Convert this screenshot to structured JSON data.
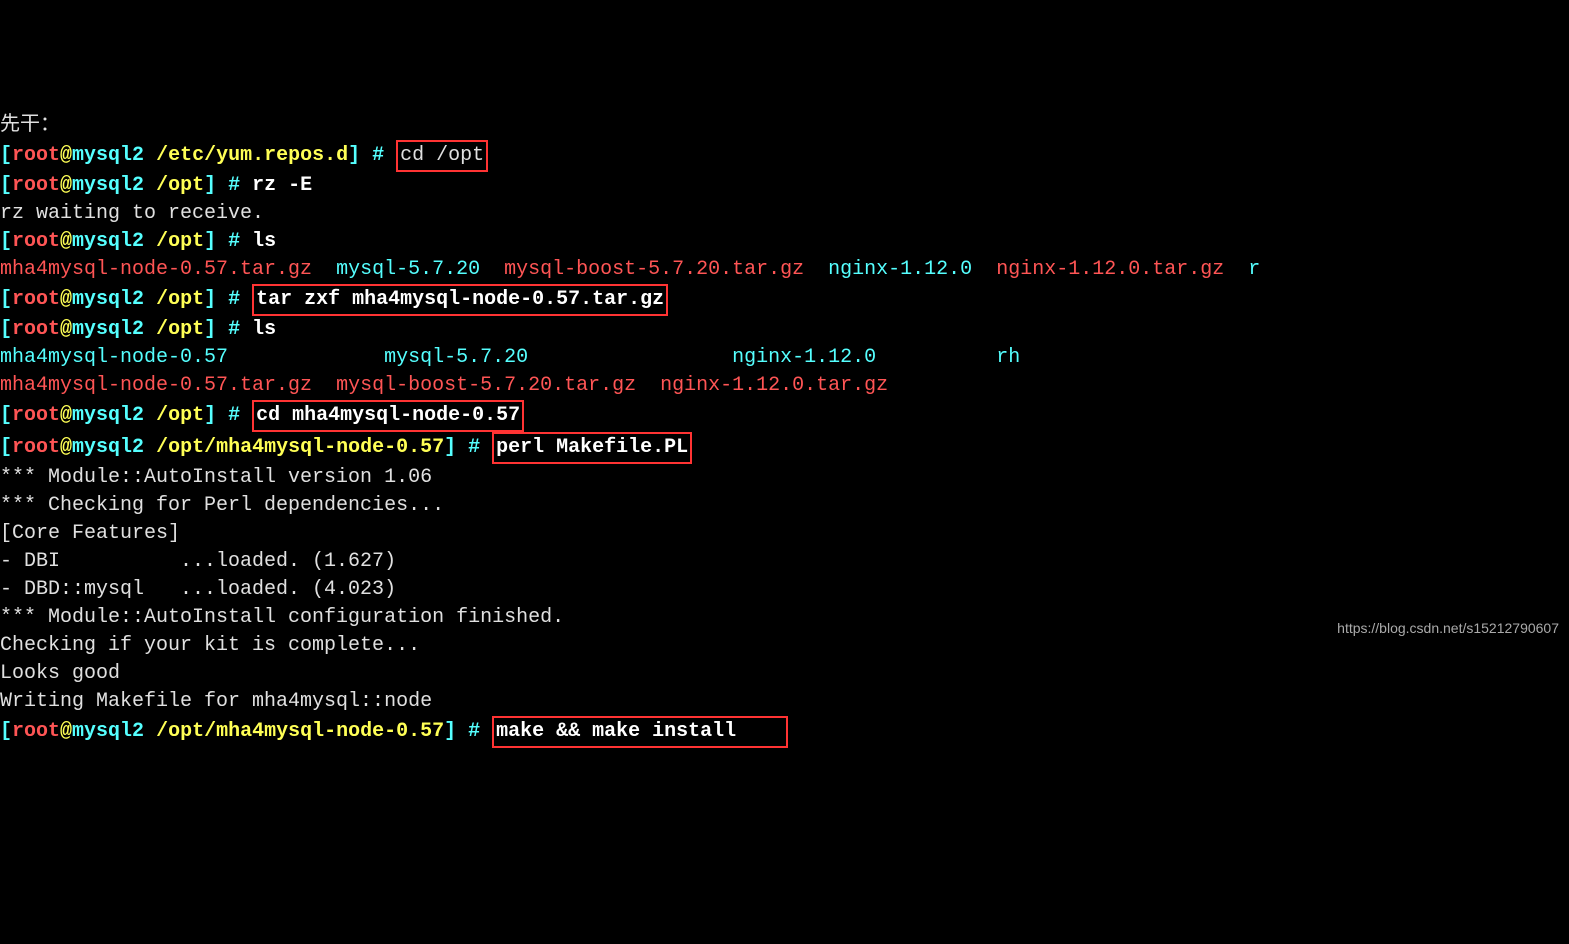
{
  "top_fragment": "先干：",
  "lines": {
    "l1_prompt_open": "[",
    "l1_user": "root",
    "l1_at": "@",
    "l1_host": "mysql2",
    "l1_path": " /etc/yum.repos.d",
    "l1_prompt_close": "] # ",
    "l1_cmd": "cd /opt",
    "l2_prompt_open": "[",
    "l2_user": "root",
    "l2_at": "@",
    "l2_host": "mysql2",
    "l2_path": " /opt",
    "l2_prompt_close": "] # ",
    "l2_cmd": "rz -E",
    "l3": "rz waiting to receive.",
    "l4_prompt_open": "[",
    "l4_user": "root",
    "l4_at": "@",
    "l4_host": "mysql2",
    "l4_path": " /opt",
    "l4_prompt_close": "] # ",
    "l4_cmd": "ls",
    "l5_a": "mha4mysql-node-0.57.tar.gz",
    "l5_b": "  mysql-5.7.20  ",
    "l5_c": "mysql-boost-5.7.20.tar.gz",
    "l5_d": "  nginx-1.12.0  ",
    "l5_e": "nginx-1.12.0.tar.gz  ",
    "l5_f": "r",
    "l6_prompt_open": "[",
    "l6_user": "root",
    "l6_at": "@",
    "l6_host": "mysql2",
    "l6_path": " /opt",
    "l6_prompt_close": "] # ",
    "l6_cmd": "tar zxf mha4mysql-node-0.57.tar.gz",
    "l7_prompt_open": "[",
    "l7_user": "root",
    "l7_at": "@",
    "l7_host": "mysql2",
    "l7_path": " /opt",
    "l7_prompt_close": "] # ",
    "l7_cmd": "ls",
    "l8_a": "mha4mysql-node-0.57",
    "l8_b": "             mysql-5.7.20",
    "l8_c": "                 nginx-1.12.0",
    "l8_d": "          rh",
    "l9_a": "mha4mysql-node-0.57.tar.gz",
    "l9_b": "  mysql-boost-5.7.20.tar.gz",
    "l9_c": "  nginx-1.12.0.tar.gz",
    "l10_prompt_open": "[",
    "l10_user": "root",
    "l10_at": "@",
    "l10_host": "mysql2",
    "l10_path": " /opt",
    "l10_prompt_close": "] # ",
    "l10_cmd": "cd mha4mysql-node-0.57",
    "l11_prompt_open": "[",
    "l11_user": "root",
    "l11_at": "@",
    "l11_host": "mysql2",
    "l11_path": " /opt/mha4mysql-node-0.57",
    "l11_prompt_close": "] # ",
    "l11_cmd": "perl Makefile.PL",
    "l12": "*** Module::AutoInstall version 1.06",
    "l13": "*** Checking for Perl dependencies...",
    "l14": "[Core Features]",
    "l15": "- DBI          ...loaded. (1.627)",
    "l16": "- DBD::mysql   ...loaded. (4.023)",
    "l17": "*** Module::AutoInstall configuration finished.",
    "l18": "Checking if your kit is complete...",
    "l19": "Looks good",
    "l20": "Writing Makefile for mha4mysql::node",
    "l21_prompt_open": "[",
    "l21_user": "root",
    "l21_at": "@",
    "l21_host": "mysql2",
    "l21_path": " /opt/mha4mysql-node-0.57",
    "l21_prompt_close": "] # ",
    "l21_cmd": "make && make install    "
  },
  "watermark": "https://blog.csdn.net/s15212790607"
}
